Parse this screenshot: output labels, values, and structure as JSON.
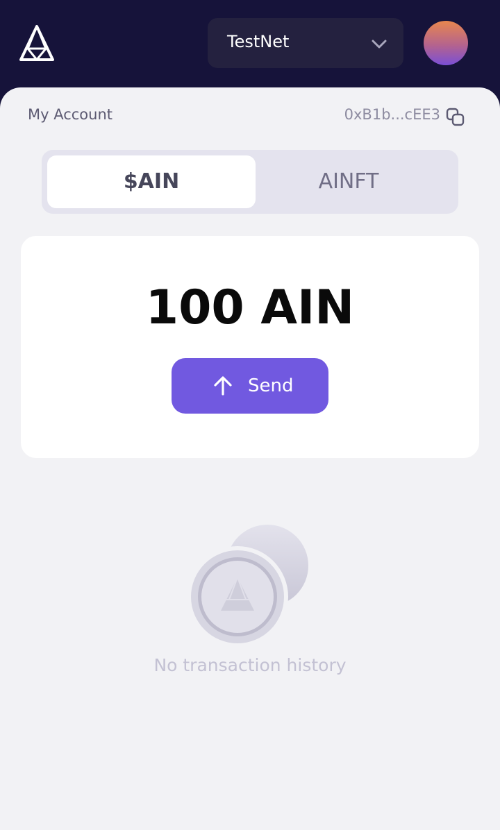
{
  "header": {
    "logo_icon": "ain-logo-icon",
    "network": {
      "selected": "TestNet",
      "icon": "chevron-down-icon"
    },
    "avatar_icon": "avatar"
  },
  "account": {
    "label": "My Account",
    "address": "0xB1b...cEE3",
    "copy_icon": "copy-icon"
  },
  "tabs": [
    {
      "label": "$AIN",
      "active": true
    },
    {
      "label": "AINFT",
      "active": false
    }
  ],
  "balance": {
    "amount": "100 AIN",
    "send_label": "Send",
    "send_icon": "arrow-up-icon"
  },
  "history": {
    "empty_text": "No transaction history",
    "icon": "coin-icon"
  },
  "colors": {
    "header_bg": "#16133a",
    "accent": "#7159e0",
    "sheet_bg": "#f2f2f5"
  }
}
